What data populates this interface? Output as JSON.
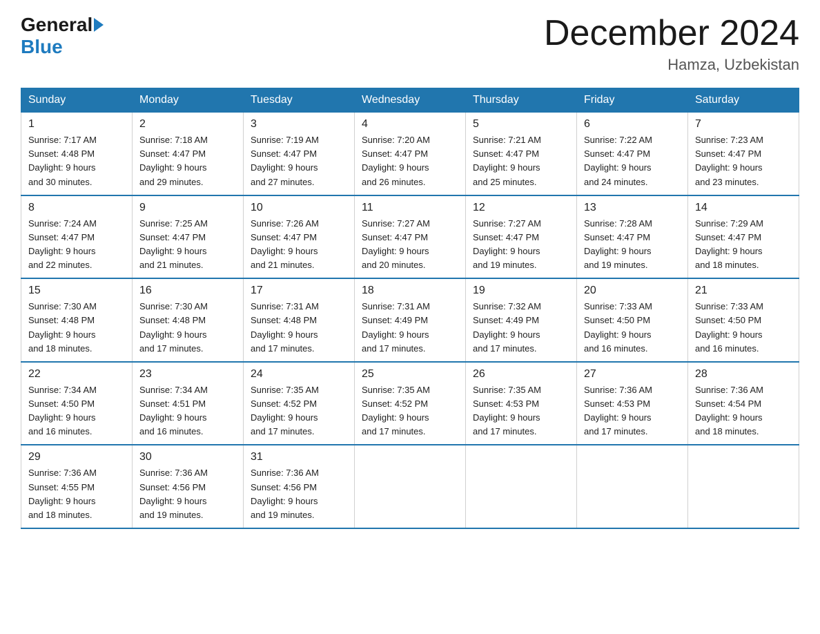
{
  "header": {
    "logo_general": "General",
    "logo_blue": "Blue",
    "month_title": "December 2024",
    "location": "Hamza, Uzbekistan"
  },
  "days_of_week": [
    "Sunday",
    "Monday",
    "Tuesday",
    "Wednesday",
    "Thursday",
    "Friday",
    "Saturday"
  ],
  "weeks": [
    [
      {
        "day": "1",
        "sunrise": "7:17 AM",
        "sunset": "4:48 PM",
        "daylight": "9 hours and 30 minutes."
      },
      {
        "day": "2",
        "sunrise": "7:18 AM",
        "sunset": "4:47 PM",
        "daylight": "9 hours and 29 minutes."
      },
      {
        "day": "3",
        "sunrise": "7:19 AM",
        "sunset": "4:47 PM",
        "daylight": "9 hours and 27 minutes."
      },
      {
        "day": "4",
        "sunrise": "7:20 AM",
        "sunset": "4:47 PM",
        "daylight": "9 hours and 26 minutes."
      },
      {
        "day": "5",
        "sunrise": "7:21 AM",
        "sunset": "4:47 PM",
        "daylight": "9 hours and 25 minutes."
      },
      {
        "day": "6",
        "sunrise": "7:22 AM",
        "sunset": "4:47 PM",
        "daylight": "9 hours and 24 minutes."
      },
      {
        "day": "7",
        "sunrise": "7:23 AM",
        "sunset": "4:47 PM",
        "daylight": "9 hours and 23 minutes."
      }
    ],
    [
      {
        "day": "8",
        "sunrise": "7:24 AM",
        "sunset": "4:47 PM",
        "daylight": "9 hours and 22 minutes."
      },
      {
        "day": "9",
        "sunrise": "7:25 AM",
        "sunset": "4:47 PM",
        "daylight": "9 hours and 21 minutes."
      },
      {
        "day": "10",
        "sunrise": "7:26 AM",
        "sunset": "4:47 PM",
        "daylight": "9 hours and 21 minutes."
      },
      {
        "day": "11",
        "sunrise": "7:27 AM",
        "sunset": "4:47 PM",
        "daylight": "9 hours and 20 minutes."
      },
      {
        "day": "12",
        "sunrise": "7:27 AM",
        "sunset": "4:47 PM",
        "daylight": "9 hours and 19 minutes."
      },
      {
        "day": "13",
        "sunrise": "7:28 AM",
        "sunset": "4:47 PM",
        "daylight": "9 hours and 19 minutes."
      },
      {
        "day": "14",
        "sunrise": "7:29 AM",
        "sunset": "4:47 PM",
        "daylight": "9 hours and 18 minutes."
      }
    ],
    [
      {
        "day": "15",
        "sunrise": "7:30 AM",
        "sunset": "4:48 PM",
        "daylight": "9 hours and 18 minutes."
      },
      {
        "day": "16",
        "sunrise": "7:30 AM",
        "sunset": "4:48 PM",
        "daylight": "9 hours and 17 minutes."
      },
      {
        "day": "17",
        "sunrise": "7:31 AM",
        "sunset": "4:48 PM",
        "daylight": "9 hours and 17 minutes."
      },
      {
        "day": "18",
        "sunrise": "7:31 AM",
        "sunset": "4:49 PM",
        "daylight": "9 hours and 17 minutes."
      },
      {
        "day": "19",
        "sunrise": "7:32 AM",
        "sunset": "4:49 PM",
        "daylight": "9 hours and 17 minutes."
      },
      {
        "day": "20",
        "sunrise": "7:33 AM",
        "sunset": "4:50 PM",
        "daylight": "9 hours and 16 minutes."
      },
      {
        "day": "21",
        "sunrise": "7:33 AM",
        "sunset": "4:50 PM",
        "daylight": "9 hours and 16 minutes."
      }
    ],
    [
      {
        "day": "22",
        "sunrise": "7:34 AM",
        "sunset": "4:50 PM",
        "daylight": "9 hours and 16 minutes."
      },
      {
        "day": "23",
        "sunrise": "7:34 AM",
        "sunset": "4:51 PM",
        "daylight": "9 hours and 16 minutes."
      },
      {
        "day": "24",
        "sunrise": "7:35 AM",
        "sunset": "4:52 PM",
        "daylight": "9 hours and 17 minutes."
      },
      {
        "day": "25",
        "sunrise": "7:35 AM",
        "sunset": "4:52 PM",
        "daylight": "9 hours and 17 minutes."
      },
      {
        "day": "26",
        "sunrise": "7:35 AM",
        "sunset": "4:53 PM",
        "daylight": "9 hours and 17 minutes."
      },
      {
        "day": "27",
        "sunrise": "7:36 AM",
        "sunset": "4:53 PM",
        "daylight": "9 hours and 17 minutes."
      },
      {
        "day": "28",
        "sunrise": "7:36 AM",
        "sunset": "4:54 PM",
        "daylight": "9 hours and 18 minutes."
      }
    ],
    [
      {
        "day": "29",
        "sunrise": "7:36 AM",
        "sunset": "4:55 PM",
        "daylight": "9 hours and 18 minutes."
      },
      {
        "day": "30",
        "sunrise": "7:36 AM",
        "sunset": "4:56 PM",
        "daylight": "9 hours and 19 minutes."
      },
      {
        "day": "31",
        "sunrise": "7:36 AM",
        "sunset": "4:56 PM",
        "daylight": "9 hours and 19 minutes."
      },
      null,
      null,
      null,
      null
    ]
  ],
  "labels": {
    "sunrise": "Sunrise:",
    "sunset": "Sunset:",
    "daylight": "Daylight:"
  }
}
